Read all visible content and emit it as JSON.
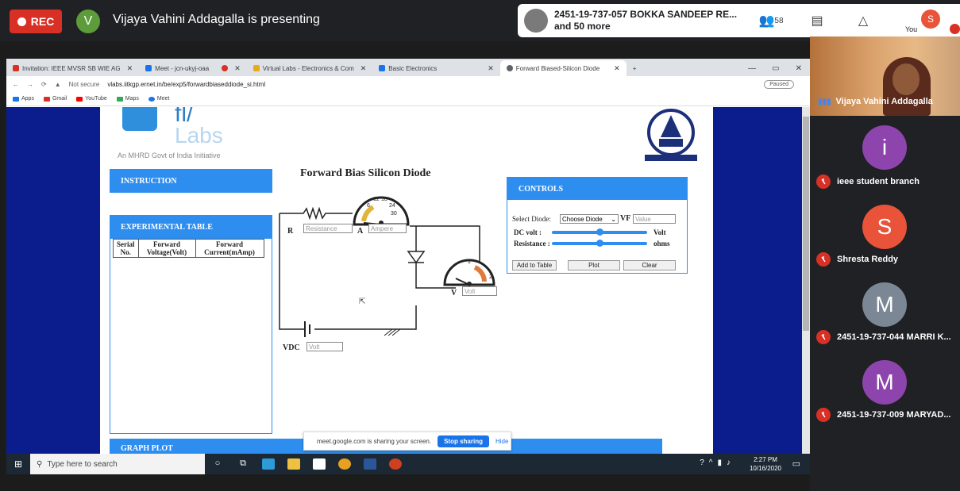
{
  "meet": {
    "rec_label": "REC",
    "presenter_initial": "V",
    "presenting_text": "Vijaya Vahini Addagalla is presenting",
    "top_participant": "2451-19-737-057 BOKKA SANDEEP RE...",
    "more_text": "and 50 more",
    "participant_count": "58",
    "you_label": "You",
    "you_initial": "S"
  },
  "browser": {
    "tabs": [
      {
        "label": "Invitation: IEEE MVSR SB WIE AG",
        "color": "#d93025"
      },
      {
        "label": "Meet - jcn-ukyj-oaa",
        "color": "#1a73e8"
      },
      {
        "label": "",
        "color": "#d93025"
      },
      {
        "label": "Virtual Labs - Electronics & Com",
        "color": "#e8a91a"
      },
      {
        "label": "Basic Electronics",
        "color": "#1a73e8"
      },
      {
        "label": "Forward Biased-Silicon Diode",
        "color": "#5f6368"
      }
    ],
    "security": "Not secure",
    "url": "vlabs.iitkgp.ernet.in/be/exp5/forwardbiaseddiode_si.html",
    "paused": "Paused",
    "bookmarks": [
      "Apps",
      "Gmail",
      "YouTube",
      "Maps",
      "Meet"
    ]
  },
  "lab": {
    "branding": {
      "logo_line1": "fl/",
      "logo_line2": "Labs",
      "tagline": "An MHRD Govt of India Initiative"
    },
    "title": "Forward Bias Silicon Diode",
    "instruction_label": "INSTRUCTION",
    "experimental_table_label": "EXPERIMENTAL TABLE",
    "table_headers": [
      "Serial No.",
      "Forward Voltage(Volt)",
      "Forward Current(mAmp)"
    ],
    "controls_label": "CONTROLS",
    "select_diode_label": "Select Diode:",
    "select_diode_value": "Choose Diode",
    "vf_label": "VF",
    "value_placeholder": "Value",
    "dc_volt_label": "DC volt :",
    "dc_volt_unit": "Volt",
    "dc_volt_level": 0.5,
    "resistance_label": "Resistance :",
    "resistance_unit": "ohms",
    "resistance_level": 0.5,
    "buttons": [
      "Add to Table",
      "Plot",
      "Clear"
    ],
    "circuit": {
      "r_label": "R",
      "resistance_placeholder": "Resistance",
      "a_label": "A",
      "ampere_placeholder": "Ampere",
      "v_label": "V",
      "volt_placeholder": "Volt",
      "vdc_label": "VDC",
      "vdc_placeholder": "Volt",
      "ammeter_ticks": [
        "6",
        "12",
        "18",
        "24",
        "30"
      ],
      "voltmeter_ticks": [
        "1",
        "2"
      ]
    },
    "graph_plot_label": "GRAPH PLOT"
  },
  "share_banner": {
    "text": "meet.google.com is sharing your screen.",
    "stop": "Stop sharing",
    "hide": "Hide"
  },
  "taskbar": {
    "search_placeholder": "Type here to search",
    "time": "2:27 PM",
    "date": "10/16/2020"
  },
  "participants": {
    "self_name": "Vijaya Vahini Addagalla",
    "list": [
      {
        "initial": "i",
        "name": "ieee student branch",
        "color": "#8e44ad"
      },
      {
        "initial": "S",
        "name": "Shresta Reddy",
        "color": "#e8533a"
      },
      {
        "initial": "M",
        "name": "2451-19-737-044 MARRI K...",
        "color": "#7b8794"
      },
      {
        "initial": "M",
        "name": "2451-19-737-009 MARYAD...",
        "color": "#8e44ad"
      }
    ]
  }
}
